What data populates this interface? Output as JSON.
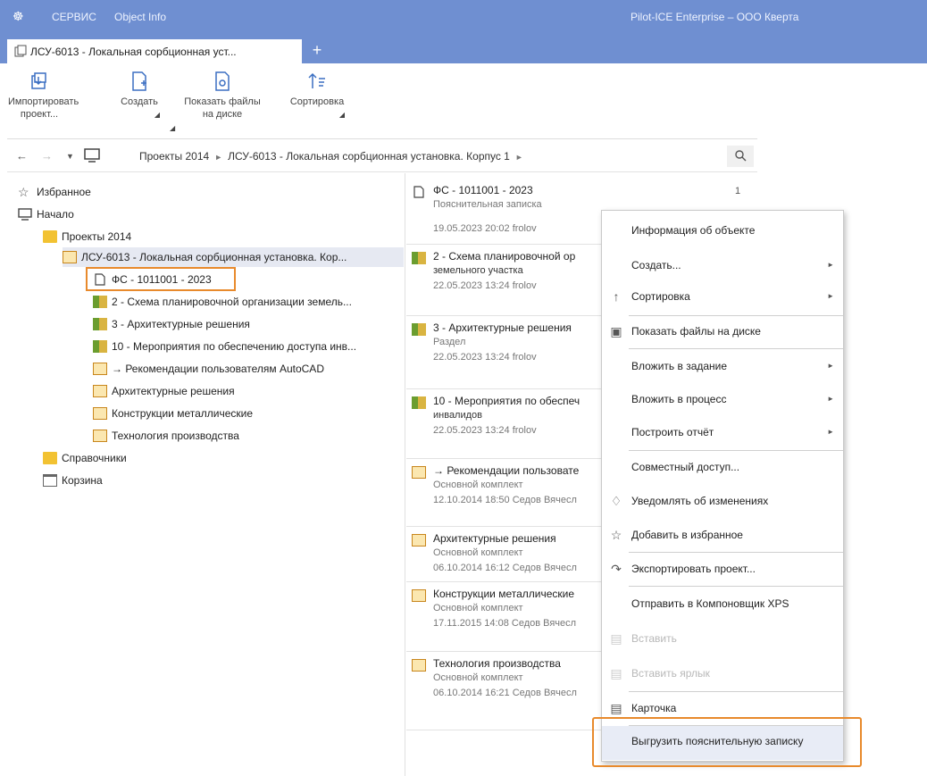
{
  "titlebar": {
    "menu_service": "СЕРВИС",
    "menu_object_info": "Object Info",
    "app_title": "Pilot-ICE Enterprise – ООО Кверта"
  },
  "tab": {
    "label": "ЛСУ-6013 - Локальная сорбционная уст...",
    "add": "+"
  },
  "ribbon": {
    "import": "Импортировать проект...",
    "create": "Создать",
    "show_files": "Показать файлы на диске",
    "sort": "Сортировка"
  },
  "navbar": {
    "crumb1": "Проекты 2014",
    "crumb2": "ЛСУ-6013 - Локальная сорбционная установка. Корпус 1"
  },
  "tree": [
    {
      "label": "Избранное"
    },
    {
      "label": "Начало"
    },
    {
      "label": "Проекты 2014"
    },
    {
      "label": "ЛСУ-6013 - Локальная сорбционная установка. Кор..."
    },
    {
      "label": "ФС - 1011001 - 2023"
    },
    {
      "label": "2 - Схема планировочной организации земель..."
    },
    {
      "label": "3 - Архитектурные решения"
    },
    {
      "label": "10 - Мероприятия по обеспечению доступа инв..."
    },
    {
      "label": "→ Рекомендации пользователям AutoCAD"
    },
    {
      "label": "Архитектурные решения"
    },
    {
      "label": "Конструкции металлические"
    },
    {
      "label": "Технология производства"
    },
    {
      "label": "Справочники"
    },
    {
      "label": "Корзина"
    }
  ],
  "list": [
    {
      "title": "ФС - 1011001 - 2023",
      "sub": "Пояснительная записка",
      "meta": "19.05.2023 20:02 frolov",
      "count": "1"
    },
    {
      "title": "2 - Схема планировочной ор",
      "sub": "земельного участка",
      "meta": "22.05.2023 13:24 frolov"
    },
    {
      "title": "3 - Архитектурные решения",
      "sub": "Раздел",
      "meta": "22.05.2023 13:24 frolov"
    },
    {
      "title": "10 - Мероприятия по обеспеч",
      "sub": "инвалидов",
      "meta": "22.05.2023 13:24 frolov"
    },
    {
      "title": "→ Рекомендации пользовате",
      "sub": "Основной комплект",
      "meta": "12.10.2014 18:50 Седов Вячесл"
    },
    {
      "title": "Архитектурные решения",
      "sub": "Основной комплект",
      "meta": "06.10.2014 16:12 Седов Вячесл"
    },
    {
      "title": "Конструкции металлические",
      "sub": "Основной комплект",
      "meta": "17.11.2015 14:08 Седов Вячесл"
    },
    {
      "title": "Технология производства",
      "sub": "Основной комплект",
      "meta": "06.10.2014 16:21 Седов Вячесл"
    }
  ],
  "context_menu": [
    {
      "label": "Информация об объекте"
    },
    {
      "label": "Создать..."
    },
    {
      "label": "Сортировка"
    },
    {
      "label": "Показать файлы на диске"
    },
    {
      "label": "Вложить в задание"
    },
    {
      "label": "Вложить в процесс"
    },
    {
      "label": "Построить отчёт"
    },
    {
      "label": "Совместный доступ..."
    },
    {
      "label": "Уведомлять об изменениях"
    },
    {
      "label": "Добавить в избранное"
    },
    {
      "label": "Экспортировать проект..."
    },
    {
      "label": "Отправить в Компоновщик XPS"
    },
    {
      "label": "Вставить"
    },
    {
      "label": "Вставить ярлык"
    },
    {
      "label": "Карточка"
    },
    {
      "label": "Выгрузить пояснительную записку"
    }
  ],
  "colors": {
    "titlebar": "#6f8fd1",
    "highlight": "#e88a2c"
  }
}
